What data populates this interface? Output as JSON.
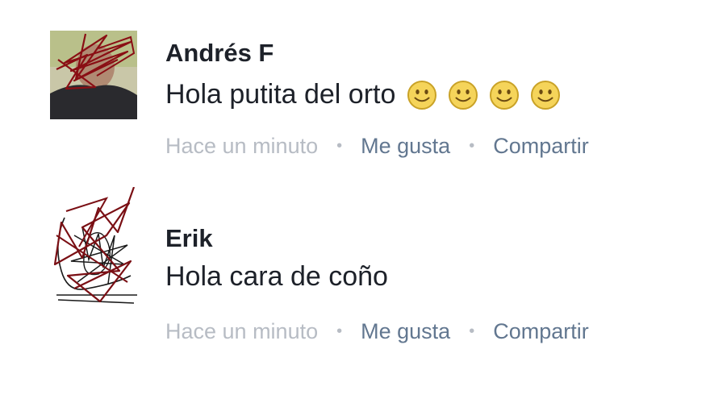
{
  "comments": [
    {
      "author": "Andrés F",
      "message": "Hola putita del orto",
      "emojis": [
        "slightly-smiling-face-icon",
        "slightly-smiling-face-icon",
        "slightly-smiling-face-icon",
        "slightly-smiling-face-icon"
      ],
      "timestamp": "Hace un minuto",
      "like_label": "Me gusta",
      "share_label": "Compartir"
    },
    {
      "author": "Erik",
      "message": "Hola cara de coño",
      "timestamp": "Hace un minuto",
      "like_label": "Me gusta",
      "share_label": "Compartir"
    }
  ],
  "separator": "•",
  "colors": {
    "text": "#1d2129",
    "timestamp": "#b7bcc4",
    "action_link": "#627790",
    "scribble": "#7a0f14",
    "emoji_fill": "#f5d45a"
  }
}
